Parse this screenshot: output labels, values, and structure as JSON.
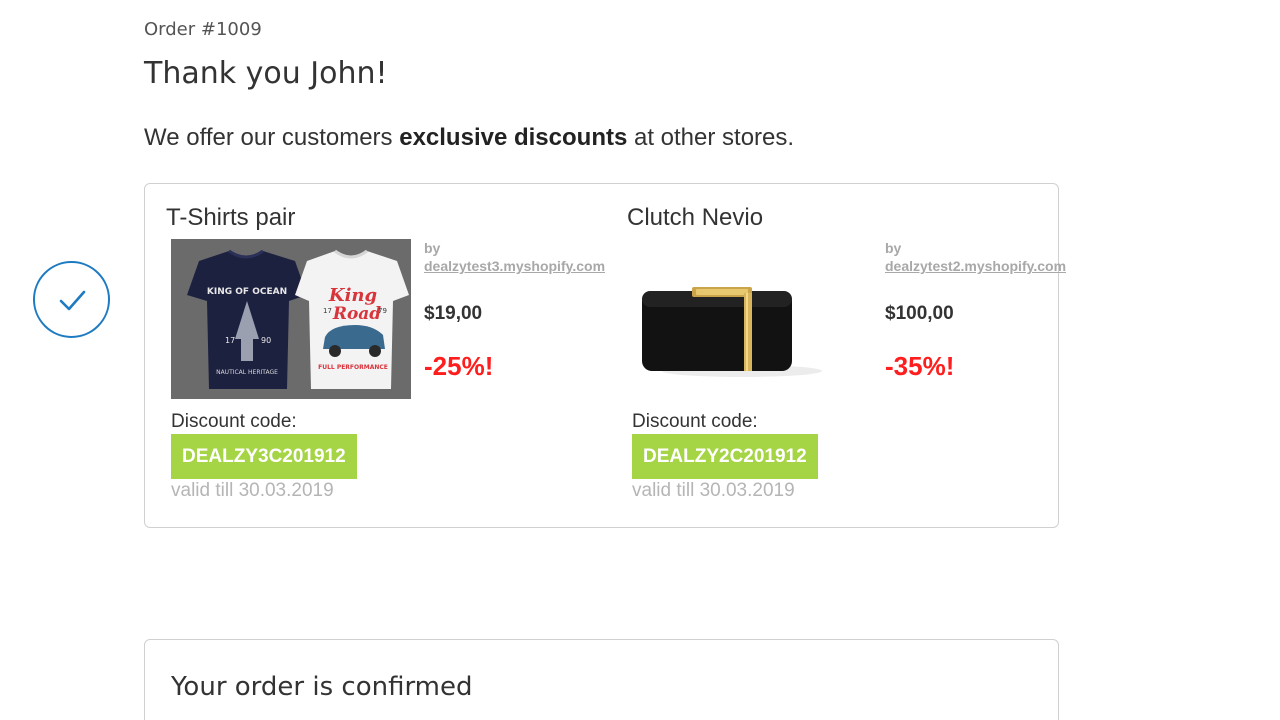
{
  "order": {
    "number": "Order #1009",
    "thank_you": "Thank you John!"
  },
  "offer_intro": {
    "before": "We offer our customers ",
    "bold": "exclusive discounts",
    "after": " at other stores."
  },
  "offers": [
    {
      "title": "T-Shirts pair",
      "image_icon": "t-shirts-image",
      "by_label": "by",
      "store": "dealzytest3.myshopify.com",
      "price": "$19,00",
      "discount_percent": "-25%!",
      "code_label": "Discount code:",
      "code": "DEALZY3C201912",
      "valid_till": "valid till 30.03.2019"
    },
    {
      "title": "Clutch Nevio",
      "image_icon": "clutch-bag-image",
      "by_label": "by",
      "store": "dealzytest2.myshopify.com",
      "price": "$100,00",
      "discount_percent": "-35%!",
      "code_label": "Discount code:",
      "code": "DEALZY2C201912",
      "valid_till": "valid till 30.03.2019"
    }
  ],
  "tshirt_prints": {
    "left_top": "KING OF OCEAN",
    "left_numbers": [
      "17",
      "90"
    ],
    "left_bottom": "NAUTICAL HERITAGE",
    "right_script_1": "King",
    "right_script_2": "Road",
    "right_numbers": [
      "17",
      "79"
    ],
    "right_bottom": "FULL PERFORMANCE"
  },
  "confirmation": {
    "title": "Your order is confirmed"
  },
  "colors": {
    "accent_blue": "#1e7bc2",
    "code_green": "#a5d444",
    "discount_red": "#ff1e1e",
    "muted_gray": "#a8a8a8"
  },
  "icons": {
    "status": "checkmark-circle-icon"
  }
}
